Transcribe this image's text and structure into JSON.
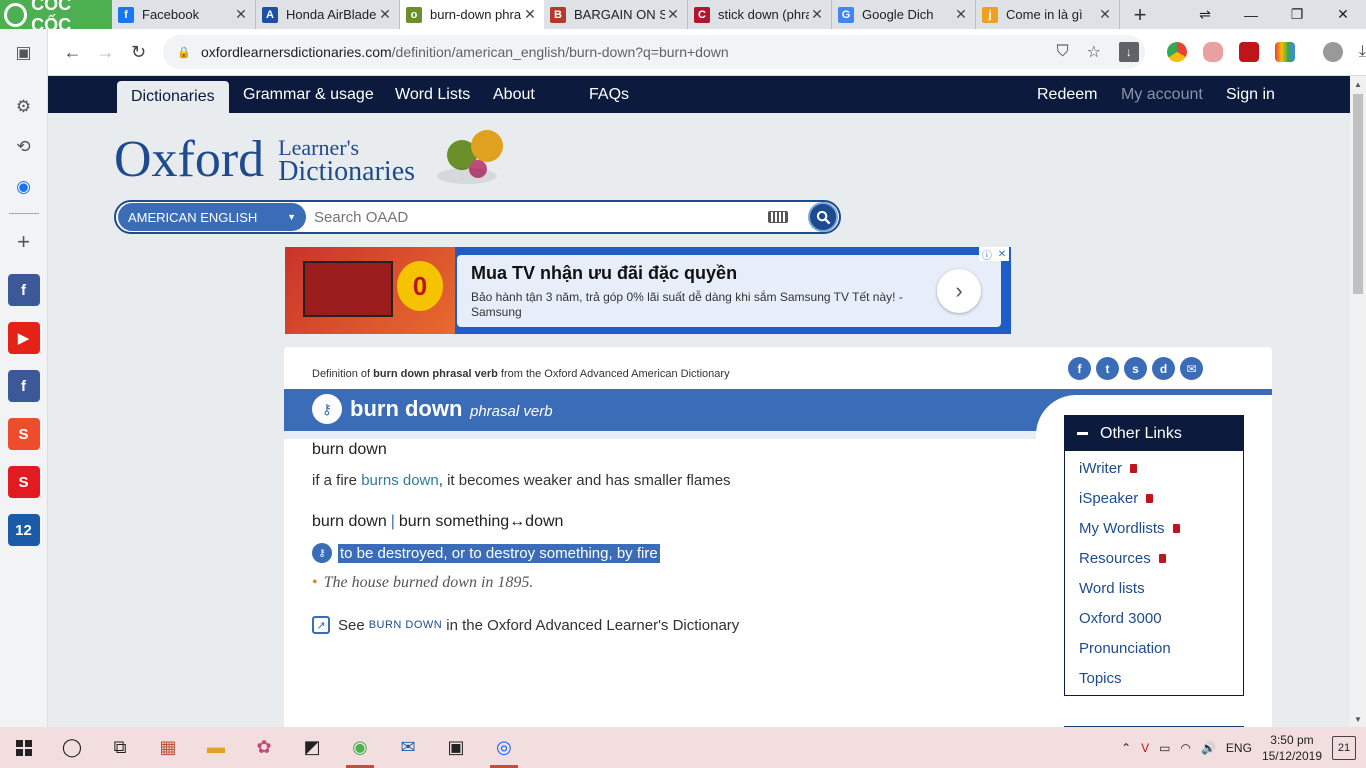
{
  "browser": {
    "brand": "CỐC CỐC",
    "tabs": [
      {
        "title": "Facebook",
        "favicon": "f",
        "color": "#1877f2"
      },
      {
        "title": "Honda AirBlade",
        "favicon": "A",
        "color": "#1f4fa3"
      },
      {
        "title": "burn-down phra",
        "favicon": "o",
        "color": "#6a8f2b",
        "active": true
      },
      {
        "title": "BARGAIN ON SC",
        "favicon": "B",
        "color": "#b5382a"
      },
      {
        "title": "stick down (phra",
        "favicon": "C",
        "color": "#b1162c"
      },
      {
        "title": "Google Dich",
        "favicon": "G",
        "color": "#4285f4"
      },
      {
        "title": "Come in là gì",
        "favicon": "j",
        "color": "#f0a020"
      }
    ],
    "url_domain": "oxfordlearnersdictionaries.com",
    "url_path": "/definition/american_english/burn-down?q=burn+down"
  },
  "sitenav": {
    "left": [
      "Dictionaries",
      "Grammar & usage",
      "Word Lists",
      "About",
      "FAQs"
    ],
    "right": [
      "Redeem",
      "My account",
      "Sign in"
    ]
  },
  "logo": {
    "oxford": "Oxford",
    "line1": "Learner's",
    "line2": "Dictionaries"
  },
  "search": {
    "dictionary": "AMERICAN ENGLISH",
    "placeholder": "Search OAAD"
  },
  "ad": {
    "badge": "0",
    "headline": "Mua TV nhận ưu đãi đặc quyền",
    "body": "Bảo hành tận 3 năm, trả góp 0% lãi suất dễ dàng khi sắm Samsung TV Tết này! - Samsung"
  },
  "entry": {
    "source_prefix": "Definition of",
    "source_bold": "burn down phrasal verb",
    "source_suffix": "from the Oxford Advanced American Dictionary",
    "headword": "burn down",
    "pos": "phrasal verb",
    "sense1_head": "burn down",
    "sense1_def_a": "if a fire ",
    "sense1_def_link": "burns down",
    "sense1_def_b": ", it becomes weaker and has smaller flames",
    "sense2_head_a": "burn down",
    "sense2_head_b": "burn something↔down",
    "sense2_def": "to be destroyed, or to destroy something, by fire",
    "example": "The house burned down in 1895.",
    "see_prefix": "See",
    "see_word": "BURN DOWN",
    "see_suffix": "in the Oxford Advanced Learner's Dictionary"
  },
  "other_links": {
    "title": "Other Links",
    "items": [
      {
        "label": "iWriter",
        "locked": true
      },
      {
        "label": "iSpeaker",
        "locked": true
      },
      {
        "label": "My Wordlists",
        "locked": true
      },
      {
        "label": "Resources",
        "locked": true
      },
      {
        "label": "Word lists",
        "locked": false
      },
      {
        "label": "Oxford 3000",
        "locked": false
      },
      {
        "label": "Pronunciation",
        "locked": false
      },
      {
        "label": "Topics",
        "locked": false
      }
    ]
  },
  "sidebar_apps": [
    {
      "name": "facebook",
      "glyph": "f",
      "color": "#3b5998"
    },
    {
      "name": "youtube",
      "glyph": "▶",
      "color": "#e62117"
    },
    {
      "name": "facebook",
      "glyph": "f",
      "color": "#3b5998"
    },
    {
      "name": "shopee",
      "glyph": "S",
      "color": "#ee4d2d"
    },
    {
      "name": "sendo",
      "glyph": "S",
      "color": "#e21b23"
    },
    {
      "name": "tiki",
      "glyph": "12",
      "color": "#1a5aa7"
    }
  ],
  "taskbar": {
    "language": "ENG",
    "time": "3:50 pm",
    "date": "15/12/2019",
    "notifications": "21"
  }
}
